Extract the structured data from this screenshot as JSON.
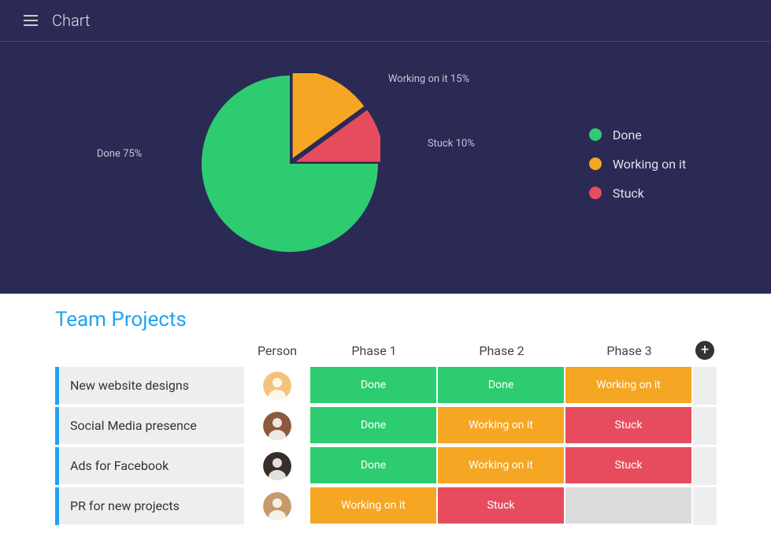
{
  "header": {
    "title": "Chart"
  },
  "chart_data": {
    "type": "pie",
    "title": "",
    "series": [
      {
        "name": "Done",
        "value": 75,
        "color": "#2ecc71"
      },
      {
        "name": "Working on it",
        "value": 15,
        "color": "#f5a623"
      },
      {
        "name": "Stuck",
        "value": 10,
        "color": "#e74c5e"
      }
    ],
    "labels": {
      "done": "Done 75%",
      "working": "Working on it 15%",
      "stuck": "Stuck 10%"
    },
    "legend": [
      {
        "label": "Done",
        "color": "#2ecc71"
      },
      {
        "label": "Working on it",
        "color": "#f5a623"
      },
      {
        "label": "Stuck",
        "color": "#e74c5e"
      }
    ]
  },
  "table": {
    "title": "Team Projects",
    "columns": {
      "person": "Person",
      "phase1": "Phase 1",
      "phase2": "Phase 2",
      "phase3": "Phase 3"
    },
    "statuses": {
      "done": "Done",
      "working": "Working on it",
      "stuck": "Stuck",
      "empty": ""
    },
    "rows": [
      {
        "task": "New website designs",
        "phase1": "done",
        "phase2": "done",
        "phase3": "working"
      },
      {
        "task": "Social Media presence",
        "phase1": "done",
        "phase2": "working",
        "phase3": "stuck"
      },
      {
        "task": "Ads for Facebook",
        "phase1": "done",
        "phase2": "working",
        "phase3": "stuck"
      },
      {
        "task": "PR for new projects",
        "phase1": "working",
        "phase2": "stuck",
        "phase3": "empty"
      }
    ]
  },
  "colors": {
    "done": "#2ecc71",
    "working": "#f5a623",
    "stuck": "#e74c5e",
    "empty": "#dcdcdc",
    "accent": "#1fa3f2",
    "panel": "#2a2a55"
  }
}
